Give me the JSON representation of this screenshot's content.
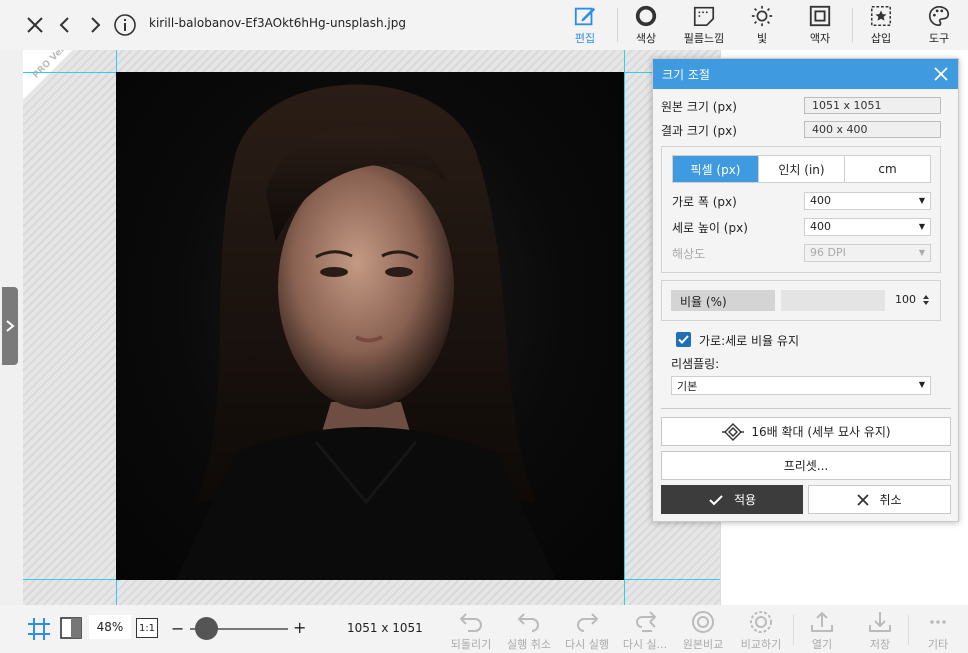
{
  "topbar": {
    "filename": "kirill-balobanov-Ef3AOkt6hHg-unsplash.jpg",
    "tools": [
      {
        "label": "편집",
        "icon": "edit-icon"
      },
      {
        "label": "색상",
        "icon": "color-icon"
      },
      {
        "label": "필름느낌",
        "icon": "film-icon"
      },
      {
        "label": "빛",
        "icon": "light-icon"
      },
      {
        "label": "액자",
        "icon": "frame-icon"
      },
      {
        "label": "삽입",
        "icon": "insert-icon"
      },
      {
        "label": "도구",
        "icon": "palette-icon"
      }
    ]
  },
  "canvas": {
    "badge": "PRO Version"
  },
  "dialog": {
    "title": "크기 조절",
    "original_label": "원본 크기 (px)",
    "original_value": "1051 x 1051",
    "result_label": "결과 크기 (px)",
    "result_value": "400 x 400",
    "units": [
      "픽셀 (px)",
      "인치 (in)",
      "cm"
    ],
    "width_label": "가로 폭 (px)",
    "width_value": "400",
    "height_label": "세로 높이 (px)",
    "height_value": "400",
    "resolution_label": "해상도",
    "resolution_value": "96 DPI",
    "ratio_label": "비율 (%)",
    "ratio_value": "100",
    "keep_ratio_label": "가로:세로 비율 유지",
    "resampling_label": "리샘플링:",
    "resampling_value": "기본",
    "upscale_label": "16배 확대 (세부 묘사 유지)",
    "preset_label": "프리셋...",
    "apply_label": "적용",
    "cancel_label": "취소"
  },
  "bottombar": {
    "zoom": "48%",
    "one_to_one": "1:1",
    "dimensions": "1051 x 1051",
    "actions": [
      {
        "label": "되돌리기"
      },
      {
        "label": "실행 취소"
      },
      {
        "label": "다시 실행"
      },
      {
        "label": "다시 실..."
      },
      {
        "label": "원본비교"
      },
      {
        "label": "비교하기"
      },
      {
        "label": "열기"
      },
      {
        "label": "저장"
      },
      {
        "label": "기타"
      }
    ]
  },
  "colors": {
    "accent": "#3f9ae0",
    "guide": "#38c8e8",
    "apply_button": "#3c3c3c"
  }
}
